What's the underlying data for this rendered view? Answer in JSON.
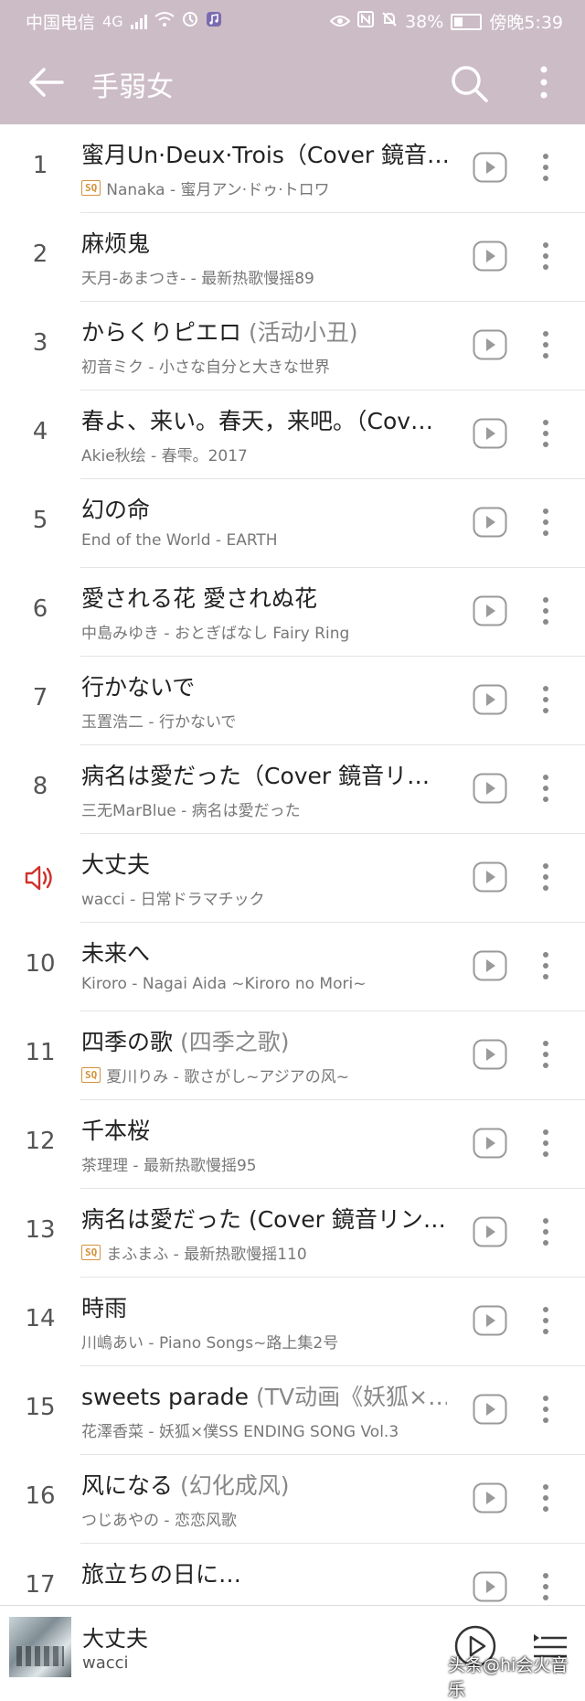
{
  "status_bar": {
    "carrier": "中国电信",
    "network": "4G",
    "battery": "38%",
    "time": "傍晚5:39"
  },
  "header": {
    "title": "手弱女",
    "icons": [
      "back-arrow-icon",
      "search-icon",
      "more-vert-icon"
    ]
  },
  "songs": [
    {
      "index": "1",
      "title": "蜜月Un·Deux·Trois（Cover 鏡音…",
      "suffix": "",
      "sq": true,
      "subtitle": "Nanaka - 蜜月アン·ドゥ·トロワ"
    },
    {
      "index": "2",
      "title": "麻烦鬼",
      "suffix": "",
      "sq": false,
      "subtitle": "天月-あまつき- - 最新热歌慢摇89"
    },
    {
      "index": "3",
      "title": "からくりピエロ",
      "suffix": " (活动小丑)",
      "sq": false,
      "subtitle": "初音ミク - 小さな自分と大きな世界"
    },
    {
      "index": "4",
      "title": "春よ、来い。春天，来吧。（Cov…",
      "suffix": "",
      "sq": false,
      "subtitle": "Akie秋绘 - 春雫。2017"
    },
    {
      "index": "5",
      "title": "幻の命",
      "suffix": "",
      "sq": false,
      "subtitle": "End of the World - EARTH"
    },
    {
      "index": "6",
      "title": "愛される花 愛されぬ花",
      "suffix": "",
      "sq": false,
      "subtitle": "中島みゆき - おとぎばなし Fairy Ring"
    },
    {
      "index": "7",
      "title": "行かないで",
      "suffix": "",
      "sq": false,
      "subtitle": "玉置浩二 - 行かないで"
    },
    {
      "index": "8",
      "title": "病名は愛だった（Cover 鏡音リ…",
      "suffix": "",
      "sq": false,
      "subtitle": "三无MarBlue - 病名は愛だった"
    },
    {
      "index": "",
      "title": "大丈夫",
      "suffix": "",
      "sq": false,
      "playing": true,
      "subtitle": "wacci - 日常ドラマチック"
    },
    {
      "index": "10",
      "title": "未来へ",
      "suffix": "",
      "sq": false,
      "subtitle": "Kiroro - Nagai Aida ~Kiroro no Mori~"
    },
    {
      "index": "11",
      "title": "四季の歌",
      "suffix": " (四季之歌)",
      "sq": true,
      "subtitle": "夏川りみ - 歌さがし~アジアの风~"
    },
    {
      "index": "12",
      "title": "千本桜",
      "suffix": "",
      "sq": false,
      "subtitle": "茶理理 - 最新热歌慢摇95"
    },
    {
      "index": "13",
      "title": "病名は愛だった (Cover 鏡音リン…",
      "suffix": "",
      "sq": true,
      "subtitle": "まふまふ - 最新热歌慢摇110"
    },
    {
      "index": "14",
      "title": "時雨",
      "suffix": "",
      "sq": false,
      "subtitle": "川嶋あい - Piano Songs~路上集2号"
    },
    {
      "index": "15",
      "title": "sweets parade",
      "suffix": " (TV动画《妖狐×…",
      "sq": false,
      "subtitle": "花澤香菜 - 妖狐×僕SS ENDING SONG Vol.3"
    },
    {
      "index": "16",
      "title": "风になる",
      "suffix": " (幻化成风)",
      "sq": false,
      "subtitle": "つじあやの - 恋恋风歌"
    },
    {
      "index": "17",
      "title": "旅立ちの日に…",
      "suffix": "",
      "sq": false,
      "subtitle": ""
    }
  ],
  "sq_badge_label": "SQ",
  "mini_player": {
    "title": "大丈夫",
    "artist": "wacci"
  },
  "watermark": "头条@hi会火音乐"
}
